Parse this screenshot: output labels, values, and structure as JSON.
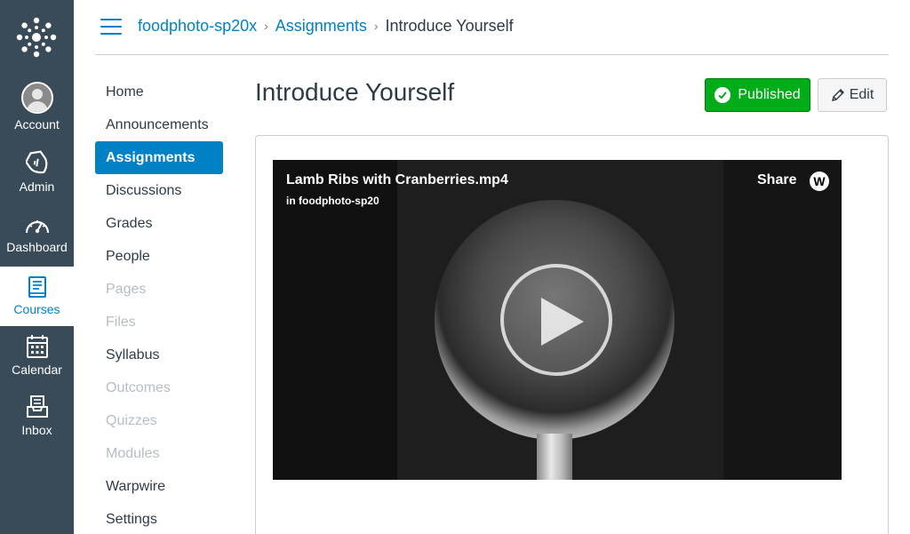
{
  "global_nav": {
    "logo_icon": "canvas-logo-icon",
    "items": [
      {
        "id": "account",
        "label": "Account",
        "icon": "avatar"
      },
      {
        "id": "admin",
        "label": "Admin",
        "icon": "shield-icon"
      },
      {
        "id": "dashboard",
        "label": "Dashboard",
        "icon": "dashboard-icon"
      },
      {
        "id": "courses",
        "label": "Courses",
        "icon": "courses-icon",
        "active": true
      },
      {
        "id": "calendar",
        "label": "Calendar",
        "icon": "calendar-icon"
      },
      {
        "id": "inbox",
        "label": "Inbox",
        "icon": "inbox-icon"
      }
    ]
  },
  "header": {
    "breadcrumbs": [
      "foodphoto-sp20x",
      "Assignments",
      "Introduce Yourself"
    ]
  },
  "course_nav": {
    "items": [
      {
        "label": "Home",
        "state": "normal"
      },
      {
        "label": "Announcements",
        "state": "normal"
      },
      {
        "label": "Assignments",
        "state": "active"
      },
      {
        "label": "Discussions",
        "state": "normal"
      },
      {
        "label": "Grades",
        "state": "normal"
      },
      {
        "label": "People",
        "state": "normal"
      },
      {
        "label": "Pages",
        "state": "disabled"
      },
      {
        "label": "Files",
        "state": "disabled"
      },
      {
        "label": "Syllabus",
        "state": "normal"
      },
      {
        "label": "Outcomes",
        "state": "disabled"
      },
      {
        "label": "Quizzes",
        "state": "disabled"
      },
      {
        "label": "Modules",
        "state": "disabled"
      },
      {
        "label": "Warpwire",
        "state": "normal"
      },
      {
        "label": "Settings",
        "state": "normal"
      }
    ]
  },
  "main": {
    "title": "Introduce Yourself",
    "published_label": "Published",
    "edit_label": "Edit"
  },
  "video": {
    "title": "Lamb Ribs with Cranberries.mp4",
    "subtitle": "in foodphoto-sp20",
    "share_label": "Share",
    "brand_letter": "W"
  },
  "colors": {
    "global_nav_bg": "#394b58",
    "accent": "#0081c6",
    "published_green": "#00ac18",
    "disabled_text": "#b4bec4"
  }
}
